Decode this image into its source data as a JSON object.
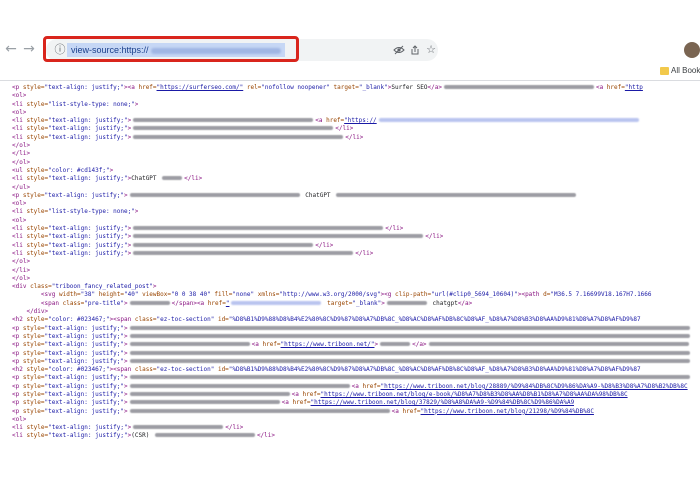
{
  "browser": {
    "nav": {
      "back": "←",
      "forward": "→"
    },
    "address": {
      "url_prefix": "view-source:https://"
    },
    "bookmarks_label": "All Bookm",
    "icons": [
      "info-icon",
      "eye-off-icon",
      "share-icon",
      "star-icon",
      "avatar"
    ]
  },
  "source_lines": [
    [
      {
        "t": "tag",
        "v": "<p "
      },
      {
        "t": "attr",
        "v": "style="
      },
      {
        "t": "val",
        "v": "\"text-align: justify;\""
      },
      {
        "t": "tag",
        "v": "><a "
      },
      {
        "t": "attr",
        "v": "href="
      },
      {
        "t": "link",
        "v": "\"https://surferseo.com/\""
      },
      {
        "t": "attr",
        "v": " rel="
      },
      {
        "t": "val",
        "v": "\"nofollow noopener\""
      },
      {
        "t": "attr",
        "v": " target="
      },
      {
        "t": "val",
        "v": "\"_blank\""
      },
      {
        "t": "tag",
        "v": ">"
      },
      {
        "t": "text",
        "v": "Surfer SEO"
      },
      {
        "t": "tag",
        "v": "</a>"
      },
      {
        "t": "blurtext",
        "w": 150
      },
      {
        "t": "tag",
        "v": "<a "
      },
      {
        "t": "attr",
        "v": "href="
      },
      {
        "t": "link",
        "v": "\"http"
      }
    ],
    [
      {
        "t": "tag",
        "v": "<ol>"
      }
    ],
    [
      {
        "t": "tag",
        "v": "<li "
      },
      {
        "t": "attr",
        "v": "style="
      },
      {
        "t": "val",
        "v": "\"list-style-type: none;\""
      },
      {
        "t": "tag",
        "v": ">"
      }
    ],
    [
      {
        "t": "tag",
        "v": "<ol>"
      }
    ],
    [
      {
        "t": "tag",
        "v": "<li "
      },
      {
        "t": "attr",
        "v": "style="
      },
      {
        "t": "val",
        "v": "\"text-align: justify;\""
      },
      {
        "t": "tag",
        "v": ">"
      },
      {
        "t": "blurtext",
        "w": 180
      },
      {
        "t": "tag",
        "v": "<a "
      },
      {
        "t": "attr",
        "v": "href="
      },
      {
        "t": "link",
        "v": "\"https://"
      },
      {
        "t": "blurlink",
        "w": 260
      }
    ],
    [
      {
        "t": "tag",
        "v": "<li "
      },
      {
        "t": "attr",
        "v": "style="
      },
      {
        "t": "val",
        "v": "\"text-align: justify;\""
      },
      {
        "t": "tag",
        "v": ">"
      },
      {
        "t": "blurtext",
        "w": 200
      },
      {
        "t": "tag",
        "v": "</li>"
      }
    ],
    [
      {
        "t": "tag",
        "v": "<li "
      },
      {
        "t": "attr",
        "v": "style="
      },
      {
        "t": "val",
        "v": "\"text-align: justify;\""
      },
      {
        "t": "tag",
        "v": ">"
      },
      {
        "t": "blurtext",
        "w": 210
      },
      {
        "t": "tag",
        "v": "</li>"
      }
    ],
    [
      {
        "t": "tag",
        "v": "</ol>"
      }
    ],
    [
      {
        "t": "tag",
        "v": "</li>"
      }
    ],
    [
      {
        "t": "tag",
        "v": "</ol>"
      }
    ],
    [
      {
        "t": "tag",
        "v": "<ul "
      },
      {
        "t": "attr",
        "v": "style="
      },
      {
        "t": "val",
        "v": "\"color: #cd143f;\""
      },
      {
        "t": "tag",
        "v": ">"
      }
    ],
    [
      {
        "t": "tag",
        "v": "<li "
      },
      {
        "t": "attr",
        "v": "style="
      },
      {
        "t": "val",
        "v": "\"text-align: justify;\""
      },
      {
        "t": "tag",
        "v": ">"
      },
      {
        "t": "text",
        "v": "ChatGPT "
      },
      {
        "t": "blurtext",
        "w": 20
      },
      {
        "t": "tag",
        "v": "</li>"
      }
    ],
    [
      {
        "t": "tag",
        "v": "</ul>"
      }
    ],
    [
      {
        "t": "tag",
        "v": "<p "
      },
      {
        "t": "attr",
        "v": "style="
      },
      {
        "t": "val",
        "v": "\"text-align: justify;\""
      },
      {
        "t": "tag",
        "v": ">"
      },
      {
        "t": "blurtext",
        "w": 170
      },
      {
        "t": "text",
        "v": " ChatGPT "
      },
      {
        "t": "blurtext",
        "w": 240
      }
    ],
    [
      {
        "t": "tag",
        "v": "<ol>"
      }
    ],
    [
      {
        "t": "tag",
        "v": "<li "
      },
      {
        "t": "attr",
        "v": "style="
      },
      {
        "t": "val",
        "v": "\"list-style-type: none;\""
      },
      {
        "t": "tag",
        "v": ">"
      }
    ],
    [
      {
        "t": "tag",
        "v": "<ol>"
      }
    ],
    [
      {
        "t": "tag",
        "v": "<li "
      },
      {
        "t": "attr",
        "v": "style="
      },
      {
        "t": "val",
        "v": "\"text-align: justify;\""
      },
      {
        "t": "tag",
        "v": ">"
      },
      {
        "t": "blurtext",
        "w": 250
      },
      {
        "t": "tag",
        "v": "</li>"
      }
    ],
    [
      {
        "t": "tag",
        "v": "<li "
      },
      {
        "t": "attr",
        "v": "style="
      },
      {
        "t": "val",
        "v": "\"text-align: justify;\""
      },
      {
        "t": "tag",
        "v": ">"
      },
      {
        "t": "blurtext",
        "w": 290
      },
      {
        "t": "tag",
        "v": "</li>"
      }
    ],
    [
      {
        "t": "tag",
        "v": "<li "
      },
      {
        "t": "attr",
        "v": "style="
      },
      {
        "t": "val",
        "v": "\"text-align: justify;\""
      },
      {
        "t": "tag",
        "v": ">"
      },
      {
        "t": "blurtext",
        "w": 180
      },
      {
        "t": "tag",
        "v": "</li>"
      }
    ],
    [
      {
        "t": "tag",
        "v": "<li "
      },
      {
        "t": "attr",
        "v": "style="
      },
      {
        "t": "val",
        "v": "\"text-align: justify;\""
      },
      {
        "t": "tag",
        "v": ">"
      },
      {
        "t": "blurtext",
        "w": 220
      },
      {
        "t": "tag",
        "v": "</li>"
      }
    ],
    [
      {
        "t": "tag",
        "v": "</ol>"
      }
    ],
    [
      {
        "t": "tag",
        "v": "</li>"
      }
    ],
    [
      {
        "t": "tag",
        "v": "</ol>"
      }
    ],
    [
      {
        "t": "tag",
        "v": "<div "
      },
      {
        "t": "attr",
        "v": "class="
      },
      {
        "t": "val",
        "v": "\"triboon_fancy_related_post\""
      },
      {
        "t": "tag",
        "v": ">"
      }
    ],
    [
      {
        "t": "text",
        "v": "        "
      },
      {
        "t": "tag",
        "v": "<svg "
      },
      {
        "t": "attr",
        "v": "width="
      },
      {
        "t": "val",
        "v": "\"38\""
      },
      {
        "t": "attr",
        "v": " height="
      },
      {
        "t": "val",
        "v": "\"40\""
      },
      {
        "t": "attr",
        "v": " viewBox="
      },
      {
        "t": "val",
        "v": "\"0 0 38 40\""
      },
      {
        "t": "attr",
        "v": " fill="
      },
      {
        "t": "val",
        "v": "\"none\""
      },
      {
        "t": "attr",
        "v": " xmlns="
      },
      {
        "t": "val",
        "v": "\"http://www.w3.org/2000/svg\""
      },
      {
        "t": "tag",
        "v": "><g "
      },
      {
        "t": "attr",
        "v": "clip-path="
      },
      {
        "t": "val",
        "v": "\"url(#clip0_5694_10604)\""
      },
      {
        "t": "tag",
        "v": "><path "
      },
      {
        "t": "attr",
        "v": "d="
      },
      {
        "t": "val",
        "v": "\"M36.5 7.16699V18.167H7.1666"
      }
    ],
    [
      {
        "t": "text",
        "v": "        "
      },
      {
        "t": "tag",
        "v": "<span "
      },
      {
        "t": "attr",
        "v": "class="
      },
      {
        "t": "val",
        "v": "\"pre-title\""
      },
      {
        "t": "tag",
        "v": ">"
      },
      {
        "t": "blurtext",
        "w": 40
      },
      {
        "t": "tag",
        "v": "</span><a "
      },
      {
        "t": "attr",
        "v": "href="
      },
      {
        "t": "link",
        "v": "\""
      },
      {
        "t": "blurlink",
        "w": 90
      },
      {
        "t": "attr",
        "v": " target="
      },
      {
        "t": "val",
        "v": "\"_blank\""
      },
      {
        "t": "tag",
        "v": ">"
      },
      {
        "t": "blurtext",
        "w": 40
      },
      {
        "t": "text",
        "v": " chatgpt"
      },
      {
        "t": "tag",
        "v": "</a>"
      }
    ],
    [
      {
        "t": "text",
        "v": "    "
      },
      {
        "t": "tag",
        "v": "</div>"
      }
    ],
    [
      {
        "t": "tag",
        "v": "<h2 "
      },
      {
        "t": "attr",
        "v": "style="
      },
      {
        "t": "val",
        "v": "\"color: #023467;\""
      },
      {
        "t": "tag",
        "v": "><span "
      },
      {
        "t": "attr",
        "v": "class="
      },
      {
        "t": "val",
        "v": "\"ez-toc-section\""
      },
      {
        "t": "attr",
        "v": " id="
      },
      {
        "t": "val",
        "v": "\"%D8%B1%D9%88%D8%B4%E2%80%8C%D9%87%D8%A7%DB%8C_%D8%AC%D8%AF%DB%8C%D8%AF_%D8%A7%D8%B3%D8%AA%D9%81%D8%A7%D8%AF%D9%87"
      }
    ],
    [
      {
        "t": "tag",
        "v": "<p "
      },
      {
        "t": "attr",
        "v": "style="
      },
      {
        "t": "val",
        "v": "\"text-align: justify;\""
      },
      {
        "t": "tag",
        "v": ">"
      },
      {
        "t": "blurtext",
        "w": 560
      }
    ],
    [
      {
        "t": "tag",
        "v": "<p "
      },
      {
        "t": "attr",
        "v": "style="
      },
      {
        "t": "val",
        "v": "\"text-align: justify;\""
      },
      {
        "t": "tag",
        "v": ">"
      },
      {
        "t": "blurtext",
        "w": 560
      }
    ],
    [
      {
        "t": "tag",
        "v": "<p "
      },
      {
        "t": "attr",
        "v": "style="
      },
      {
        "t": "val",
        "v": "\"text-align: justify;\""
      },
      {
        "t": "tag",
        "v": ">"
      },
      {
        "t": "blurtext",
        "w": 120
      },
      {
        "t": "tag",
        "v": "<a "
      },
      {
        "t": "attr",
        "v": "href="
      },
      {
        "t": "link",
        "v": "\"https://www.triboon.net/\""
      },
      {
        "t": "tag",
        "v": ">"
      },
      {
        "t": "blurtext",
        "w": 30
      },
      {
        "t": "tag",
        "v": "</a>"
      },
      {
        "t": "blurtext",
        "w": 260
      }
    ],
    [
      {
        "t": "tag",
        "v": "<p "
      },
      {
        "t": "attr",
        "v": "style="
      },
      {
        "t": "val",
        "v": "\"text-align: justify;\""
      },
      {
        "t": "tag",
        "v": ">"
      },
      {
        "t": "blurtext",
        "w": 560
      }
    ],
    [
      {
        "t": "tag",
        "v": "<p "
      },
      {
        "t": "attr",
        "v": "style="
      },
      {
        "t": "val",
        "v": "\"text-align: justify;\""
      },
      {
        "t": "tag",
        "v": ">"
      },
      {
        "t": "blurtext",
        "w": 560
      }
    ],
    [
      {
        "t": "tag",
        "v": "<h2 "
      },
      {
        "t": "attr",
        "v": "style="
      },
      {
        "t": "val",
        "v": "\"color: #023467;\""
      },
      {
        "t": "tag",
        "v": "><span "
      },
      {
        "t": "attr",
        "v": "class="
      },
      {
        "t": "val",
        "v": "\"ez-toc-section\""
      },
      {
        "t": "attr",
        "v": " id="
      },
      {
        "t": "val",
        "v": "\"%D8%B1%D9%88%D8%B4%E2%80%8C%D9%87%D8%A7%DB%8C_%D8%AC%D8%AF%DB%8C%D8%AF_%D8%A7%D8%B3%D8%AA%D9%81%D8%A7%D8%AF%D9%87"
      }
    ],
    [
      {
        "t": "tag",
        "v": "<p "
      },
      {
        "t": "attr",
        "v": "style="
      },
      {
        "t": "val",
        "v": "\"text-align: justify;\""
      },
      {
        "t": "tag",
        "v": ">"
      },
      {
        "t": "blurtext",
        "w": 560
      }
    ],
    [
      {
        "t": "tag",
        "v": "<p "
      },
      {
        "t": "attr",
        "v": "style="
      },
      {
        "t": "val",
        "v": "\"text-align: justify;\""
      },
      {
        "t": "tag",
        "v": ">"
      },
      {
        "t": "blurtext",
        "w": 220
      },
      {
        "t": "tag",
        "v": "<a "
      },
      {
        "t": "attr",
        "v": "href="
      },
      {
        "t": "link",
        "v": "\"https://www.triboon.net/blog/28889/%D9%84%DB%8C%D9%86%DA%A9-%D8%B3%D8%A7%D8%B2%DB%8C"
      }
    ],
    [
      {
        "t": "tag",
        "v": "<p "
      },
      {
        "t": "attr",
        "v": "style="
      },
      {
        "t": "val",
        "v": "\"text-align: justify;\""
      },
      {
        "t": "tag",
        "v": ">"
      },
      {
        "t": "blurtext",
        "w": 160
      },
      {
        "t": "tag",
        "v": "<a "
      },
      {
        "t": "attr",
        "v": "href="
      },
      {
        "t": "link",
        "v": "\"https://www.triboon.net/blog/e-book/%D8%A7%D8%B3%D8%AA%D8%B1%D8%A7%D8%AA%DA%98%DB%8C"
      }
    ],
    [
      {
        "t": "tag",
        "v": "<p "
      },
      {
        "t": "attr",
        "v": "style="
      },
      {
        "t": "val",
        "v": "\"text-align: justify;\""
      },
      {
        "t": "tag",
        "v": ">"
      },
      {
        "t": "blurtext",
        "w": 150
      },
      {
        "t": "tag",
        "v": "<a "
      },
      {
        "t": "attr",
        "v": "href="
      },
      {
        "t": "link",
        "v": "\"https://www.triboon.net/blog/37829/%D8%A8%DA%A9-%D9%84%DB%8C%D9%86%DA%A9"
      }
    ],
    [
      {
        "t": "tag",
        "v": "<p "
      },
      {
        "t": "attr",
        "v": "style="
      },
      {
        "t": "val",
        "v": "\"text-align: justify;\""
      },
      {
        "t": "tag",
        "v": ">"
      },
      {
        "t": "blurtext",
        "w": 260
      },
      {
        "t": "tag",
        "v": "<a "
      },
      {
        "t": "attr",
        "v": "href="
      },
      {
        "t": "link",
        "v": "\"https://www.triboon.net/blog/21298/%D9%84%DB%8C"
      }
    ],
    [
      {
        "t": "tag",
        "v": "<ol>"
      }
    ],
    [
      {
        "t": "tag",
        "v": "<li "
      },
      {
        "t": "attr",
        "v": "style="
      },
      {
        "t": "val",
        "v": "\"text-align: justify;\""
      },
      {
        "t": "tag",
        "v": ">"
      },
      {
        "t": "blurtext",
        "w": 90
      },
      {
        "t": "tag",
        "v": "</li>"
      }
    ],
    [
      {
        "t": "tag",
        "v": "<li "
      },
      {
        "t": "attr",
        "v": "style="
      },
      {
        "t": "val",
        "v": "\"text-align: justify;\""
      },
      {
        "t": "tag",
        "v": ">"
      },
      {
        "t": "text",
        "v": "(CSR) "
      },
      {
        "t": "blurtext",
        "w": 100
      },
      {
        "t": "tag",
        "v": "</li>"
      }
    ]
  ]
}
